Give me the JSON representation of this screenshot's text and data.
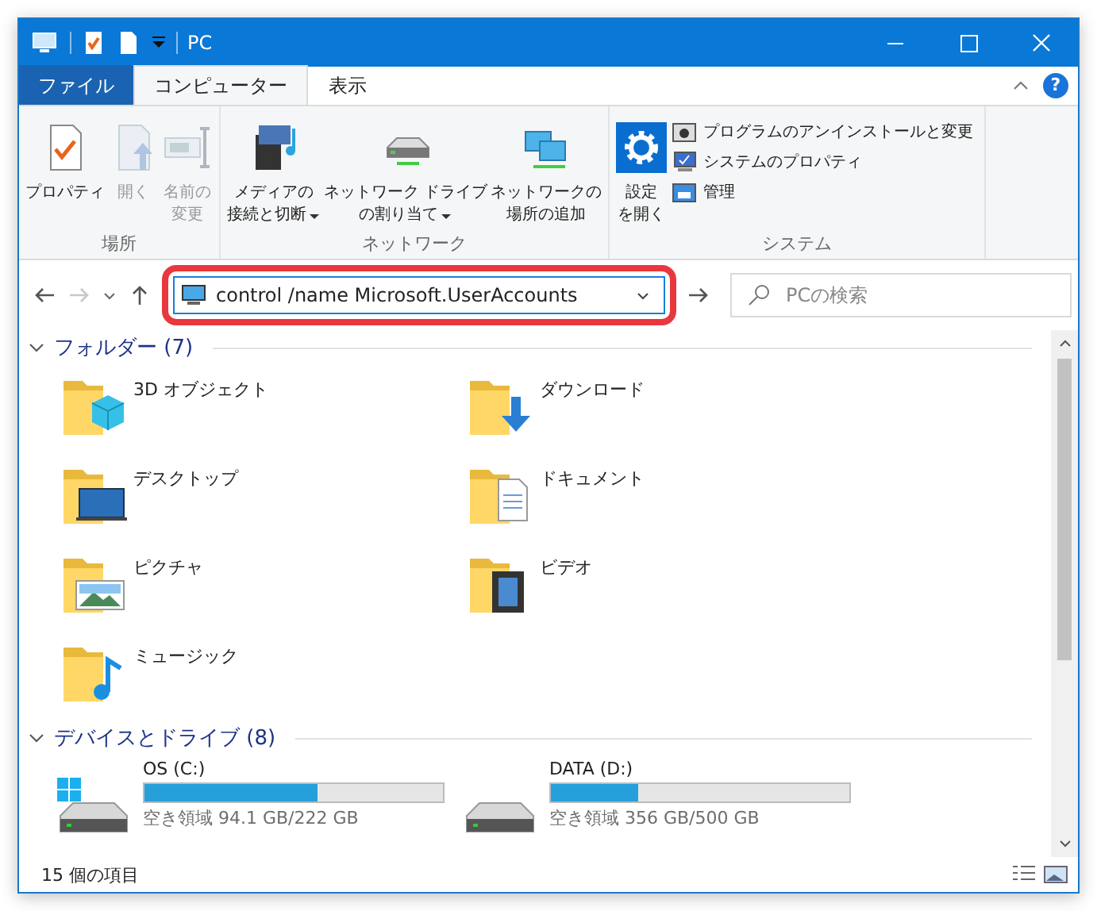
{
  "window": {
    "title": "PC"
  },
  "tabs": [
    {
      "label": "ファイル",
      "kind": "file",
      "selected": false
    },
    {
      "label": "コンピューター",
      "kind": "tab",
      "selected": true
    },
    {
      "label": "表示",
      "kind": "tab",
      "selected": false
    }
  ],
  "ribbon": [
    {
      "label": "場所",
      "items": [
        {
          "kind": "properties",
          "lines": [
            "プロパティ"
          ],
          "disabled": false,
          "dropdown": false
        },
        {
          "kind": "open",
          "lines": [
            "開く"
          ],
          "disabled": true,
          "dropdown": false
        },
        {
          "kind": "rename",
          "lines": [
            "名前の",
            "変更"
          ],
          "disabled": true,
          "dropdown": false
        }
      ]
    },
    {
      "label": "ネットワーク",
      "items": [
        {
          "kind": "media",
          "lines": [
            "メディアの",
            "接続と切断"
          ],
          "disabled": false,
          "dropdown": true
        },
        {
          "kind": "drive",
          "lines": [
            "ネットワーク ドライブ",
            "の割り当て"
          ],
          "disabled": false,
          "dropdown": true
        },
        {
          "kind": "netloc",
          "lines": [
            "ネットワークの",
            "場所の追加"
          ],
          "disabled": false,
          "dropdown": false
        }
      ]
    },
    {
      "label": "システム",
      "items": [
        {
          "kind": "settings",
          "lines": [
            "設定",
            "を開く"
          ],
          "disabled": false,
          "dropdown": false
        }
      ],
      "small_items": [
        {
          "kind": "uninstall",
          "label": "プログラムのアンインストールと変更"
        },
        {
          "kind": "sysprops",
          "label": "システムのプロパティ"
        },
        {
          "kind": "manage",
          "label": "管理"
        }
      ]
    }
  ],
  "help_button": "?",
  "address": {
    "value": "control /name Microsoft.UserAccounts",
    "highlighted": true
  },
  "nav": {
    "forward_disabled": true
  },
  "search": {
    "placeholder": "PCの検索"
  },
  "sections": [
    {
      "title": "フォルダー (7)",
      "expanded": true,
      "folders": [
        {
          "name": "3D オブジェクト",
          "kind": "cube"
        },
        {
          "name": "ダウンロード",
          "kind": "download"
        },
        {
          "name": "デスクトップ",
          "kind": "desktop"
        },
        {
          "name": "ドキュメント",
          "kind": "document"
        },
        {
          "name": "ピクチャ",
          "kind": "picture"
        },
        {
          "name": "ビデオ",
          "kind": "film"
        },
        {
          "name": "ミュージック",
          "kind": "music"
        }
      ]
    },
    {
      "title": "デバイスとドライブ (8)",
      "expanded": true,
      "drives": [
        {
          "name": "OS (C:)",
          "kind": "windows",
          "level": 0.58,
          "free": "空き領域 94.1 GB/222 GB"
        },
        {
          "name": "DATA (D:)",
          "kind": "plain",
          "level": 0.29,
          "free": "空き領域 356 GB/500 GB"
        }
      ]
    }
  ],
  "status_bar": {
    "count": "15 個の項目"
  }
}
